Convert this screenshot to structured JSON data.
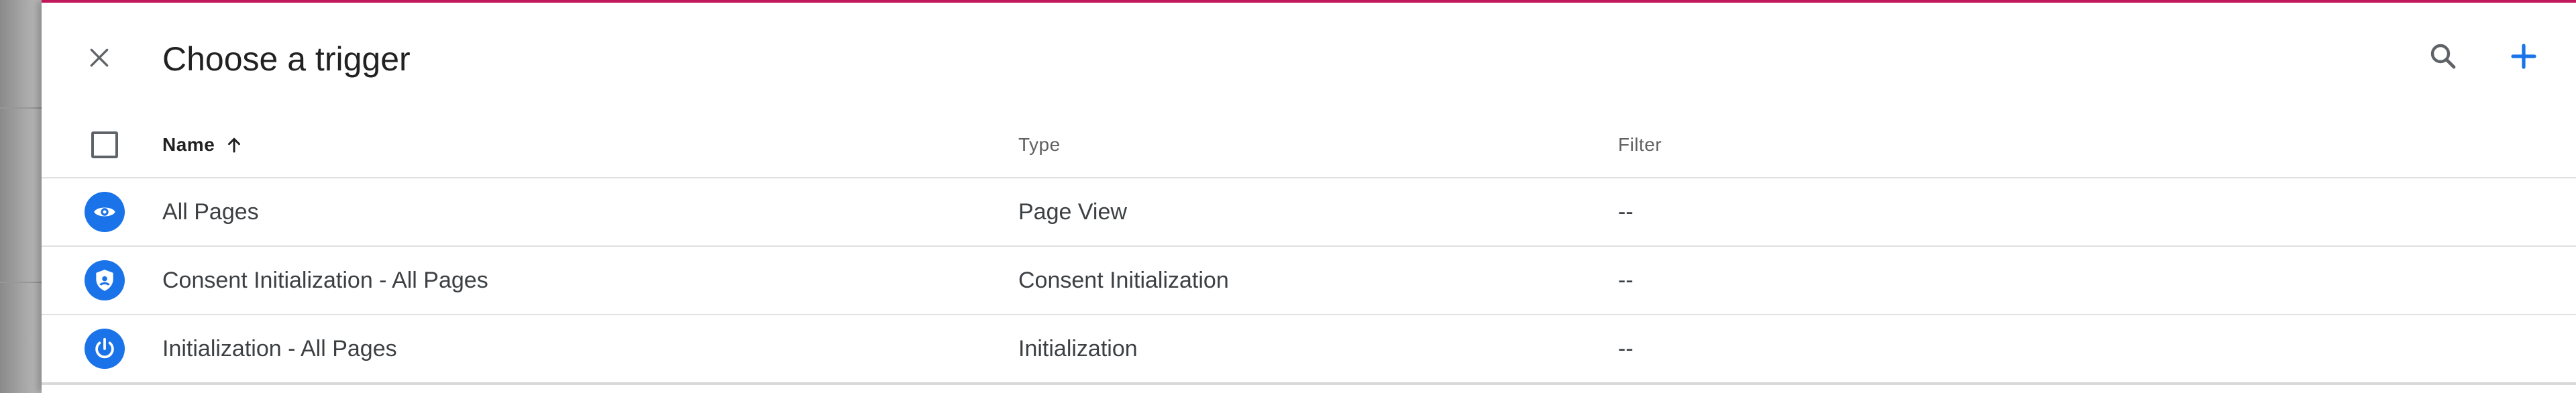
{
  "dialog": {
    "title": "Choose a trigger"
  },
  "colors": {
    "accent": "#1a73e8",
    "top_bar": "#c2185b"
  },
  "icons": {
    "close": "close-icon",
    "search": "search-icon",
    "add": "plus-icon",
    "sort": "arrow-up-icon"
  },
  "table": {
    "columns": {
      "name": "Name",
      "type": "Type",
      "filter": "Filter"
    },
    "sort": {
      "column": "name",
      "direction": "ascending"
    },
    "rows": [
      {
        "icon": "eye-icon",
        "name": "All Pages",
        "type": "Page View",
        "filter": "--"
      },
      {
        "icon": "shield-icon",
        "name": "Consent Initialization - All Pages",
        "type": "Consent Initialization",
        "filter": "--"
      },
      {
        "icon": "power-icon",
        "name": "Initialization - All Pages",
        "type": "Initialization",
        "filter": "--"
      }
    ]
  }
}
